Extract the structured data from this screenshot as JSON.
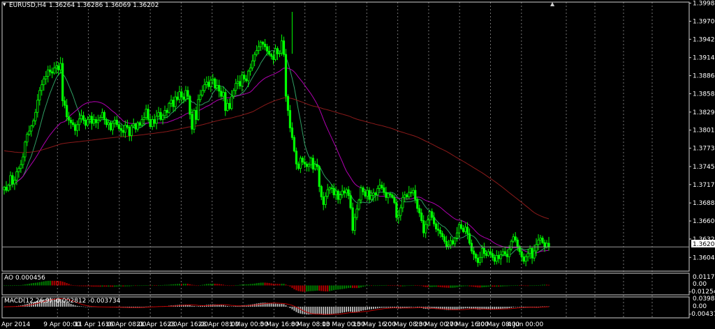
{
  "chart_data": {
    "type": "candlestick",
    "symbol_title": "EURUSD,H4",
    "ohlc_readout": "1.36264 1.36286 1.36069 1.36202",
    "colors": {
      "bull": "#00ff00",
      "bear": "#00ff00",
      "ma_fast": "#2f9f63",
      "ma_mid": "#b000b0",
      "ma_slow": "#8b1a1a",
      "ao_up": "#008000",
      "ao_down": "#b00000",
      "macd_hist": "#c0c0c0",
      "macd_signal": "#c00000",
      "grid": "#cfcfcf"
    },
    "price_axis": {
      "range": [
        1.3587,
        1.3998
      ],
      "ticks": [
        "1.39985",
        "1.39705",
        "1.39425",
        "1.39140",
        "1.38860",
        "1.38580",
        "1.38295",
        "1.38015",
        "1.37735",
        "1.37450",
        "1.37170",
        "1.36885",
        "1.36605",
        "1.36325",
        "1.36040"
      ],
      "current_price": "1.36202"
    },
    "time_axis": {
      "labels": [
        "Apr 2014",
        "9 Apr 00:00",
        "11 Apr 16:00",
        "16 Apr 08:00",
        "21 Apr 16:00",
        "23 Apr 16:00",
        "28 Apr 08:00",
        "1 May 00:00",
        "5 May 16:00",
        "8 May 08:00",
        "13 May 00:00",
        "15 May 16:00",
        "20 May 08:00",
        "23 May 00:00",
        "27 May 16:00",
        "30 May 08:00",
        "4 Jun 00:00"
      ]
    },
    "closes": [
      1.3713,
      1.3708,
      1.3716,
      1.3731,
      1.3718,
      1.3724,
      1.3737,
      1.3742,
      1.3748,
      1.376,
      1.3783,
      1.3795,
      1.38,
      1.3808,
      1.3816,
      1.3829,
      1.3848,
      1.3863,
      1.3872,
      1.3881,
      1.3885,
      1.3895,
      1.3892,
      1.389,
      1.3898,
      1.3901,
      1.3895,
      1.3905,
      1.3847,
      1.384,
      1.3822,
      1.3817,
      1.3813,
      1.381,
      1.3801,
      1.381,
      1.3819,
      1.3824,
      1.3817,
      1.3809,
      1.3818,
      1.3823,
      1.3812,
      1.3818,
      1.3813,
      1.3817,
      1.3821,
      1.3829,
      1.3818,
      1.381,
      1.3813,
      1.3802,
      1.3812,
      1.3817,
      1.381,
      1.3804,
      1.3801,
      1.3798,
      1.3809,
      1.3806,
      1.3793,
      1.3808,
      1.3811,
      1.3803,
      1.3813,
      1.3809,
      1.3818,
      1.3821,
      1.3834,
      1.3818,
      1.3807,
      1.3818,
      1.3812,
      1.3823,
      1.3829,
      1.3818,
      1.3824,
      1.3832,
      1.3829,
      1.3843,
      1.3848,
      1.3838,
      1.3853,
      1.3849,
      1.3861,
      1.3853,
      1.3849,
      1.3863,
      1.3854,
      1.3826,
      1.3803,
      1.3832,
      1.3818,
      1.3849,
      1.3856,
      1.3863,
      1.3872,
      1.3876,
      1.3869,
      1.3879,
      1.3881,
      1.3867,
      1.3871,
      1.3862,
      1.3854,
      1.386,
      1.3832,
      1.3843,
      1.3835,
      1.3854,
      1.3863,
      1.3874,
      1.3877,
      1.387,
      1.3887,
      1.3881,
      1.3878,
      1.3893,
      1.3898,
      1.3909,
      1.3919,
      1.3925,
      1.3931,
      1.3938,
      1.3935,
      1.3931,
      1.3924,
      1.3919,
      1.3916,
      1.3911,
      1.3928,
      1.392,
      1.3921,
      1.394,
      1.3919,
      1.3854,
      1.3832,
      1.3805,
      1.379,
      1.3769,
      1.3749,
      1.3742,
      1.3758,
      1.3752,
      1.3749,
      1.3745,
      1.3748,
      1.3758,
      1.3741,
      1.3748,
      1.3745,
      1.3714,
      1.3698,
      1.3686,
      1.3699,
      1.3709,
      1.3712,
      1.3711,
      1.3701,
      1.3707,
      1.3694,
      1.3701,
      1.3707,
      1.3704,
      1.3709,
      1.37,
      1.3681,
      1.3646,
      1.3666,
      1.3679,
      1.3693,
      1.3712,
      1.3706,
      1.3699,
      1.3708,
      1.3694,
      1.37,
      1.3704,
      1.3701,
      1.3711,
      1.3716,
      1.3712,
      1.3705,
      1.3697,
      1.3703,
      1.3701,
      1.3697,
      1.3689,
      1.3666,
      1.3669,
      1.3681,
      1.3697,
      1.3701,
      1.3698,
      1.3705,
      1.3704,
      1.3708,
      1.3694,
      1.368,
      1.3673,
      1.3661,
      1.3642,
      1.3655,
      1.3662,
      1.3675,
      1.3666,
      1.3656,
      1.3648,
      1.3646,
      1.3641,
      1.3636,
      1.3629,
      1.3621,
      1.3623,
      1.363,
      1.3625,
      1.3634,
      1.3642,
      1.3655,
      1.3649,
      1.3644,
      1.3651,
      1.3641,
      1.3626,
      1.3614,
      1.3609,
      1.3603,
      1.3596,
      1.3604,
      1.3618,
      1.361,
      1.3607,
      1.3613,
      1.361,
      1.3604,
      1.3598,
      1.3607,
      1.3602,
      1.3608,
      1.3613,
      1.3609,
      1.3605,
      1.3617,
      1.3629,
      1.3636,
      1.3631,
      1.3621,
      1.3613,
      1.3605,
      1.3598,
      1.3605,
      1.361,
      1.3618,
      1.3603,
      1.3614,
      1.3624,
      1.3631,
      1.3634,
      1.3627,
      1.362,
      1.3626,
      1.362
    ],
    "indicators": [
      {
        "name": "AO",
        "label": "AO 0.000456",
        "axis_ticks": [
          "0.01172",
          "0.00",
          "-0.01254"
        ]
      },
      {
        "name": "MACD",
        "label": "MACD(12,26,9) -0.002812 -0.003734",
        "axis_ticks": [
          "0.03983",
          "0.00",
          "-0.00437"
        ]
      }
    ]
  }
}
